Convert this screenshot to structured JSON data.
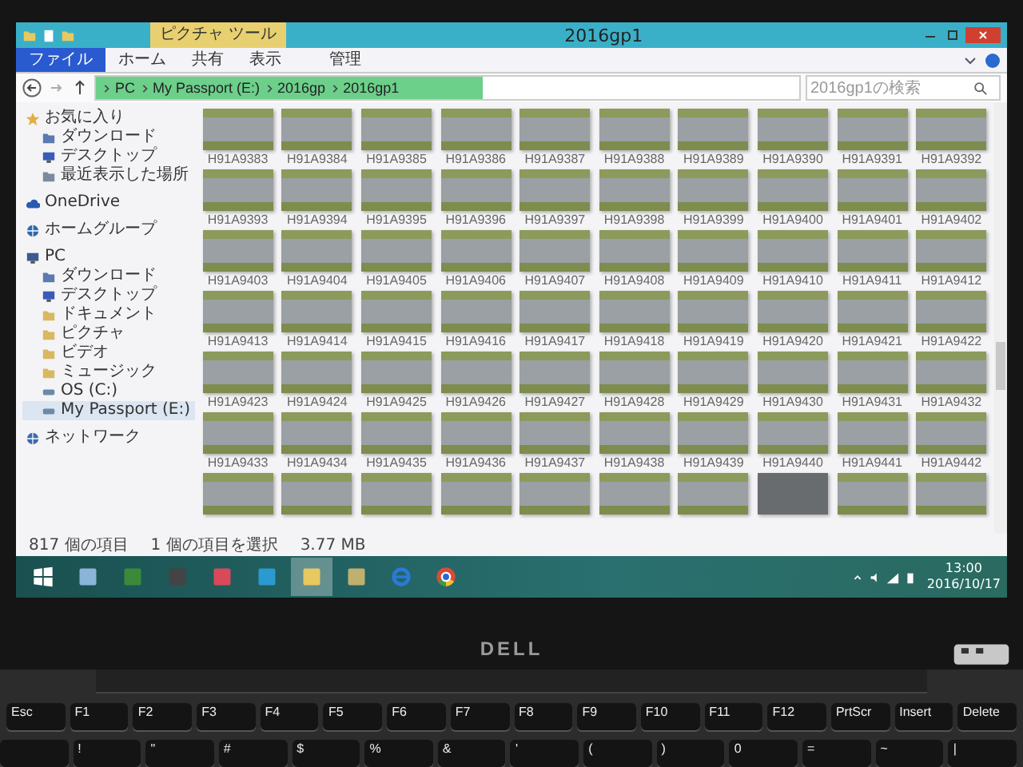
{
  "window": {
    "title": "2016gp1",
    "context_tab": "ピクチャ ツール"
  },
  "ribbon_tabs": [
    {
      "label": "ファイル",
      "kind": "file"
    },
    {
      "label": "ホーム",
      "kind": "tab"
    },
    {
      "label": "共有",
      "kind": "tab"
    },
    {
      "label": "表示",
      "kind": "tab"
    },
    {
      "label": "管理",
      "kind": "context"
    }
  ],
  "address_bar": {
    "path": [
      "PC",
      "My Passport (E:)",
      "2016gp",
      "2016gp1"
    ],
    "level": 0.55
  },
  "search": {
    "placeholder": "2016gp1の検索"
  },
  "sidebar": {
    "items": [
      {
        "label": "お気に入り",
        "kind": "star",
        "selected": false,
        "children": [
          {
            "label": "ダウンロード",
            "kind": "download",
            "selected": false
          },
          {
            "label": "デスクトップ",
            "kind": "desktop",
            "selected": false
          },
          {
            "label": "最近表示した場所",
            "kind": "recent",
            "selected": false
          }
        ]
      },
      {
        "label": "OneDrive",
        "kind": "cloud",
        "selected": false
      },
      {
        "label": "ホームグループ",
        "kind": "homegroup",
        "selected": false
      },
      {
        "label": "PC",
        "kind": "pc",
        "selected": false,
        "children": [
          {
            "label": "ダウンロード",
            "kind": "download",
            "selected": false
          },
          {
            "label": "デスクトップ",
            "kind": "desktop",
            "selected": false
          },
          {
            "label": "ドキュメント",
            "kind": "folder",
            "selected": false
          },
          {
            "label": "ピクチャ",
            "kind": "folder",
            "selected": false
          },
          {
            "label": "ビデオ",
            "kind": "folder",
            "selected": false
          },
          {
            "label": "ミュージック",
            "kind": "folder",
            "selected": false
          },
          {
            "label": "OS (C:)",
            "kind": "drive",
            "selected": false
          },
          {
            "label": "My Passport (E:)",
            "kind": "drive",
            "selected": true
          }
        ]
      },
      {
        "label": "ネットワーク",
        "kind": "network",
        "selected": false
      }
    ]
  },
  "thumbnails": [
    {
      "label": "H91A9383",
      "kind": "photo"
    },
    {
      "label": "H91A9384",
      "kind": "photo"
    },
    {
      "label": "H91A9385",
      "kind": "photo"
    },
    {
      "label": "H91A9386",
      "kind": "photo"
    },
    {
      "label": "H91A9387",
      "kind": "photo"
    },
    {
      "label": "H91A9388",
      "kind": "photo"
    },
    {
      "label": "H91A9389",
      "kind": "photo"
    },
    {
      "label": "H91A9390",
      "kind": "photo"
    },
    {
      "label": "H91A9391",
      "kind": "photo"
    },
    {
      "label": "H91A9392",
      "kind": "photo"
    },
    {
      "label": "H91A9393",
      "kind": "photo"
    },
    {
      "label": "H91A9394",
      "kind": "photo"
    },
    {
      "label": "H91A9395",
      "kind": "photo"
    },
    {
      "label": "H91A9396",
      "kind": "photo"
    },
    {
      "label": "H91A9397",
      "kind": "photo"
    },
    {
      "label": "H91A9398",
      "kind": "photo"
    },
    {
      "label": "H91A9399",
      "kind": "photo"
    },
    {
      "label": "H91A9400",
      "kind": "photo"
    },
    {
      "label": "H91A9401",
      "kind": "photo"
    },
    {
      "label": "H91A9402",
      "kind": "photo"
    },
    {
      "label": "H91A9403",
      "kind": "photo"
    },
    {
      "label": "H91A9404",
      "kind": "photo"
    },
    {
      "label": "H91A9405",
      "kind": "photo"
    },
    {
      "label": "H91A9406",
      "kind": "photo"
    },
    {
      "label": "H91A9407",
      "kind": "photo"
    },
    {
      "label": "H91A9408",
      "kind": "photo"
    },
    {
      "label": "H91A9409",
      "kind": "photo"
    },
    {
      "label": "H91A9410",
      "kind": "photo"
    },
    {
      "label": "H91A9411",
      "kind": "photo"
    },
    {
      "label": "H91A9412",
      "kind": "photo"
    },
    {
      "label": "H91A9413",
      "kind": "photo"
    },
    {
      "label": "H91A9414",
      "kind": "photo"
    },
    {
      "label": "H91A9415",
      "kind": "photo"
    },
    {
      "label": "H91A9416",
      "kind": "photo"
    },
    {
      "label": "H91A9417",
      "kind": "photo"
    },
    {
      "label": "H91A9418",
      "kind": "photo"
    },
    {
      "label": "H91A9419",
      "kind": "photo"
    },
    {
      "label": "H91A9420",
      "kind": "photo"
    },
    {
      "label": "H91A9421",
      "kind": "photo"
    },
    {
      "label": "H91A9422",
      "kind": "photo"
    },
    {
      "label": "H91A9423",
      "kind": "photo"
    },
    {
      "label": "H91A9424",
      "kind": "photo"
    },
    {
      "label": "H91A9425",
      "kind": "photo"
    },
    {
      "label": "H91A9426",
      "kind": "photo"
    },
    {
      "label": "H91A9427",
      "kind": "photo"
    },
    {
      "label": "H91A9428",
      "kind": "photo"
    },
    {
      "label": "H91A9429",
      "kind": "photo"
    },
    {
      "label": "H91A9430",
      "kind": "photo"
    },
    {
      "label": "H91A9431",
      "kind": "photo"
    },
    {
      "label": "H91A9432",
      "kind": "photo"
    },
    {
      "label": "H91A9433",
      "kind": "photo"
    },
    {
      "label": "H91A9434",
      "kind": "photo"
    },
    {
      "label": "H91A9435",
      "kind": "photo"
    },
    {
      "label": "H91A9436",
      "kind": "photo"
    },
    {
      "label": "H91A9437",
      "kind": "photo"
    },
    {
      "label": "H91A9438",
      "kind": "photo"
    },
    {
      "label": "H91A9439",
      "kind": "photo"
    },
    {
      "label": "H91A9440",
      "kind": "photo"
    },
    {
      "label": "H91A9441",
      "kind": "photo"
    },
    {
      "label": "H91A9442",
      "kind": "photo"
    },
    {
      "kind": "photo"
    },
    {
      "kind": "photo"
    },
    {
      "kind": "photo"
    },
    {
      "kind": "photo"
    },
    {
      "kind": "photo"
    },
    {
      "kind": "photo"
    },
    {
      "kind": "photo"
    },
    {
      "kind": "blank"
    },
    {
      "kind": "photo"
    },
    {
      "kind": "photo"
    }
  ],
  "status_bar": {
    "item_count": "817 個の項目",
    "selection": "1 個の項目を選択",
    "size": "3.77 MB"
  },
  "taskbar": {
    "apps": [
      {
        "kind": "start",
        "selected": false
      },
      {
        "kind": "desktop",
        "selected": false
      },
      {
        "kind": "calculator",
        "selected": false
      },
      {
        "kind": "camera",
        "selected": false
      },
      {
        "kind": "paint",
        "selected": false
      },
      {
        "kind": "viewer",
        "selected": false
      },
      {
        "kind": "explorer",
        "selected": true
      },
      {
        "kind": "network",
        "selected": false
      },
      {
        "kind": "ie",
        "selected": false
      },
      {
        "kind": "chrome",
        "selected": false
      }
    ],
    "time": "13:00",
    "date": "2016/10/17"
  },
  "laptop": {
    "brand": "DELL",
    "function_keys": [
      "Esc",
      "F1",
      "F2",
      "F3",
      "F4",
      "F5",
      "F6",
      "F7",
      "F8",
      "F9",
      "F10",
      "F11",
      "F12",
      "PrtScr",
      "Insert",
      "Delete"
    ],
    "number_keys": [
      "!",
      "\"",
      "#",
      "$",
      "%",
      "&",
      "'",
      "(",
      ")",
      "0",
      "=",
      "~",
      "|"
    ]
  }
}
